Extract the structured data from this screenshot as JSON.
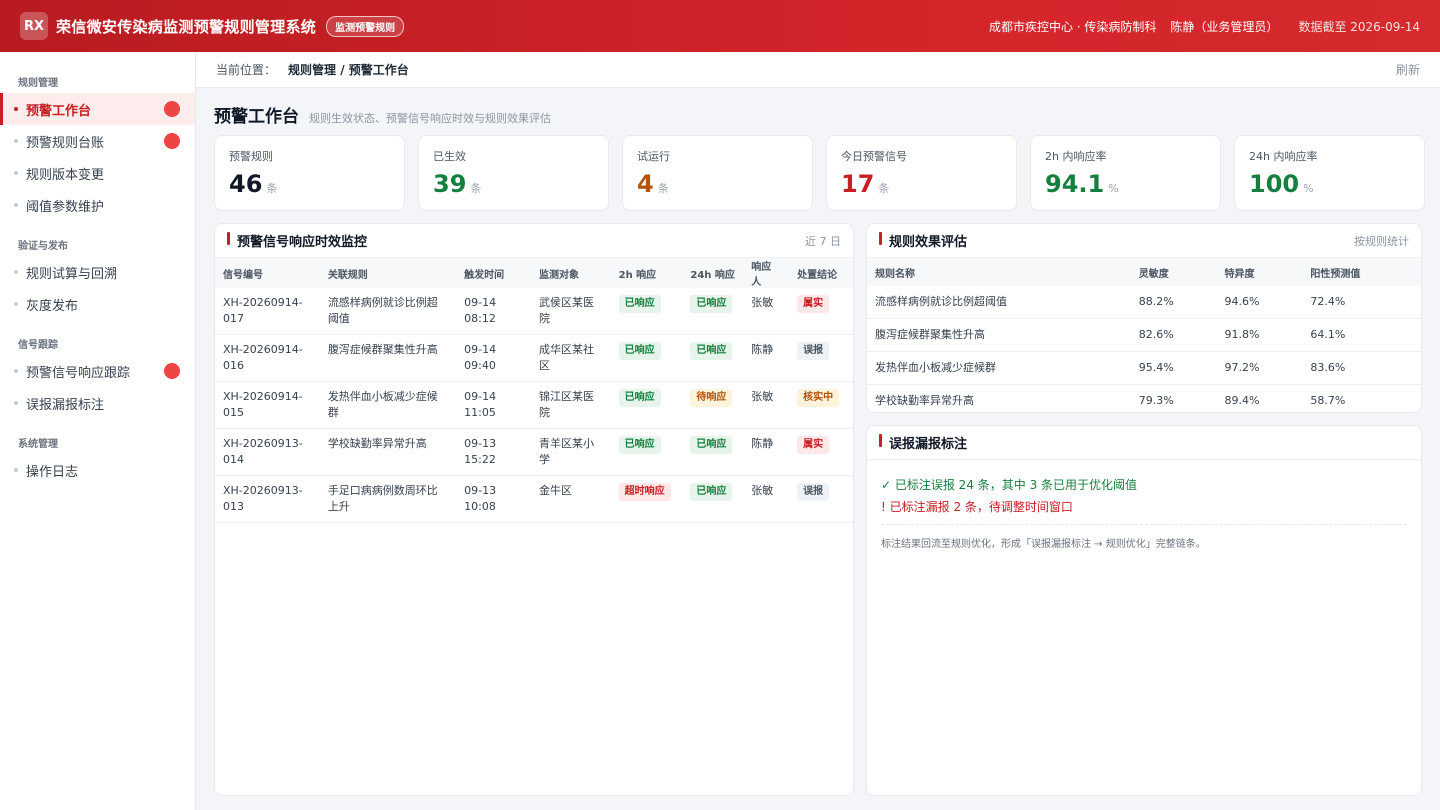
{
  "header": {
    "logo": "RX",
    "title": "荣信微安传染病监测预警规则管理系统",
    "badge": "监测预警规则",
    "org": "成都市疾控中心 · 传染病防制科",
    "user": "陈静（业务管理员）",
    "date": "数据截至 2026-09-14"
  },
  "sidebar": {
    "groups": [
      {
        "title": "规则管理",
        "items": [
          {
            "label": "预警工作台",
            "active": true,
            "alert": true
          },
          {
            "label": "预警规则台账",
            "alert": true
          },
          {
            "label": "规则版本变更"
          },
          {
            "label": "阈值参数维护"
          }
        ]
      },
      {
        "title": "验证与发布",
        "items": [
          {
            "label": "规则试算与回溯"
          },
          {
            "label": "灰度发布"
          }
        ]
      },
      {
        "title": "信号跟踪",
        "items": [
          {
            "label": "预警信号响应跟踪",
            "alert": true
          },
          {
            "label": "误报漏报标注"
          }
        ]
      },
      {
        "title": "系统管理",
        "items": [
          {
            "label": "操作日志"
          }
        ]
      }
    ]
  },
  "breadcrumb": {
    "label": "当前位置：",
    "path": "规则管理 / 预警工作台",
    "refresh": "刷新"
  },
  "page": {
    "title": "预警工作台",
    "subtitle": "规则生效状态、预警信号响应时效与规则效果评估"
  },
  "stats": [
    {
      "label": "预警规则",
      "value": "46",
      "unit": "条",
      "color": "#111827"
    },
    {
      "label": "已生效",
      "value": "39",
      "unit": "条",
      "color": "#15803d"
    },
    {
      "label": "试运行",
      "value": "4",
      "unit": "条",
      "color": "#b45309"
    },
    {
      "label": "今日预警信号",
      "value": "17",
      "unit": "条",
      "color": "#c81e24"
    },
    {
      "label": "2h 内响应率",
      "value": "94.1",
      "unit": "%",
      "color": "#15803d"
    },
    {
      "label": "24h 内响应率",
      "value": "100",
      "unit": "%",
      "color": "#15803d"
    }
  ],
  "monitor": {
    "title": "预警信号响应时效监控",
    "meta": "近 7 日",
    "columns": [
      "信号编号",
      "关联规则",
      "触发时间",
      "监测对象",
      "2h 响应",
      "24h 响应",
      "响应人",
      "处置结论"
    ],
    "rows": [
      {
        "id": "XH-20260914-017",
        "rule": "流感样病例就诊比例超阈值",
        "time": "09-14 08:12",
        "target": "武侯区某医院",
        "r2h": "已响应",
        "r2h_c": "green",
        "r24h": "已响应",
        "r24h_c": "green",
        "person": "张敏",
        "result": "属实",
        "result_c": "red"
      },
      {
        "id": "XH-20260914-016",
        "rule": "腹泻症候群聚集性升高",
        "time": "09-14 09:40",
        "target": "成华区某社区",
        "r2h": "已响应",
        "r2h_c": "green",
        "r24h": "已响应",
        "r24h_c": "green",
        "person": "陈静",
        "result": "误报",
        "result_c": "gray"
      },
      {
        "id": "XH-20260914-015",
        "rule": "发热伴血小板减少症候群",
        "time": "09-14 11:05",
        "target": "锦江区某医院",
        "r2h": "已响应",
        "r2h_c": "green",
        "r24h": "待响应",
        "r24h_c": "orange",
        "person": "张敏",
        "result": "核实中",
        "result_c": "orange"
      },
      {
        "id": "XH-20260913-014",
        "rule": "学校缺勤率异常升高",
        "time": "09-13 15:22",
        "target": "青羊区某小学",
        "r2h": "已响应",
        "r2h_c": "green",
        "r24h": "已响应",
        "r24h_c": "green",
        "person": "陈静",
        "result": "属实",
        "result_c": "red"
      },
      {
        "id": "XH-20260913-013",
        "rule": "手足口病病例数周环比上升",
        "time": "09-13 10:08",
        "target": "金牛区",
        "r2h": "超时响应",
        "r2h_c": "red",
        "r24h": "已响应",
        "r24h_c": "green",
        "person": "张敏",
        "result": "误报",
        "result_c": "gray"
      }
    ]
  },
  "evaluation": {
    "title": "规则效果评估",
    "meta": "按规则统计",
    "columns": [
      "规则名称",
      "灵敏度",
      "特异度",
      "阳性预测值"
    ],
    "rows": [
      {
        "name": "流感样病例就诊比例超阈值",
        "sens": "88.2%",
        "spec": "94.6%",
        "ppv": "72.4%"
      },
      {
        "name": "腹泻症候群聚集性升高",
        "sens": "82.6%",
        "spec": "91.8%",
        "ppv": "64.1%"
      },
      {
        "name": "发热伴血小板减少症候群",
        "sens": "95.4%",
        "spec": "97.2%",
        "ppv": "83.6%"
      },
      {
        "name": "学校缺勤率异常升高",
        "sens": "79.3%",
        "spec": "89.4%",
        "ppv": "58.7%"
      }
    ]
  },
  "feedback": {
    "title": "误报漏报标注",
    "line1": "✓ 已标注误报 24 条，其中 3 条已用于优化阈值",
    "line2": "! 已标注漏报 2 条，待调整时间窗口",
    "note": "标注结果回流至规则优化，形成「误报漏报标注 → 规则优化」完整链条。"
  }
}
